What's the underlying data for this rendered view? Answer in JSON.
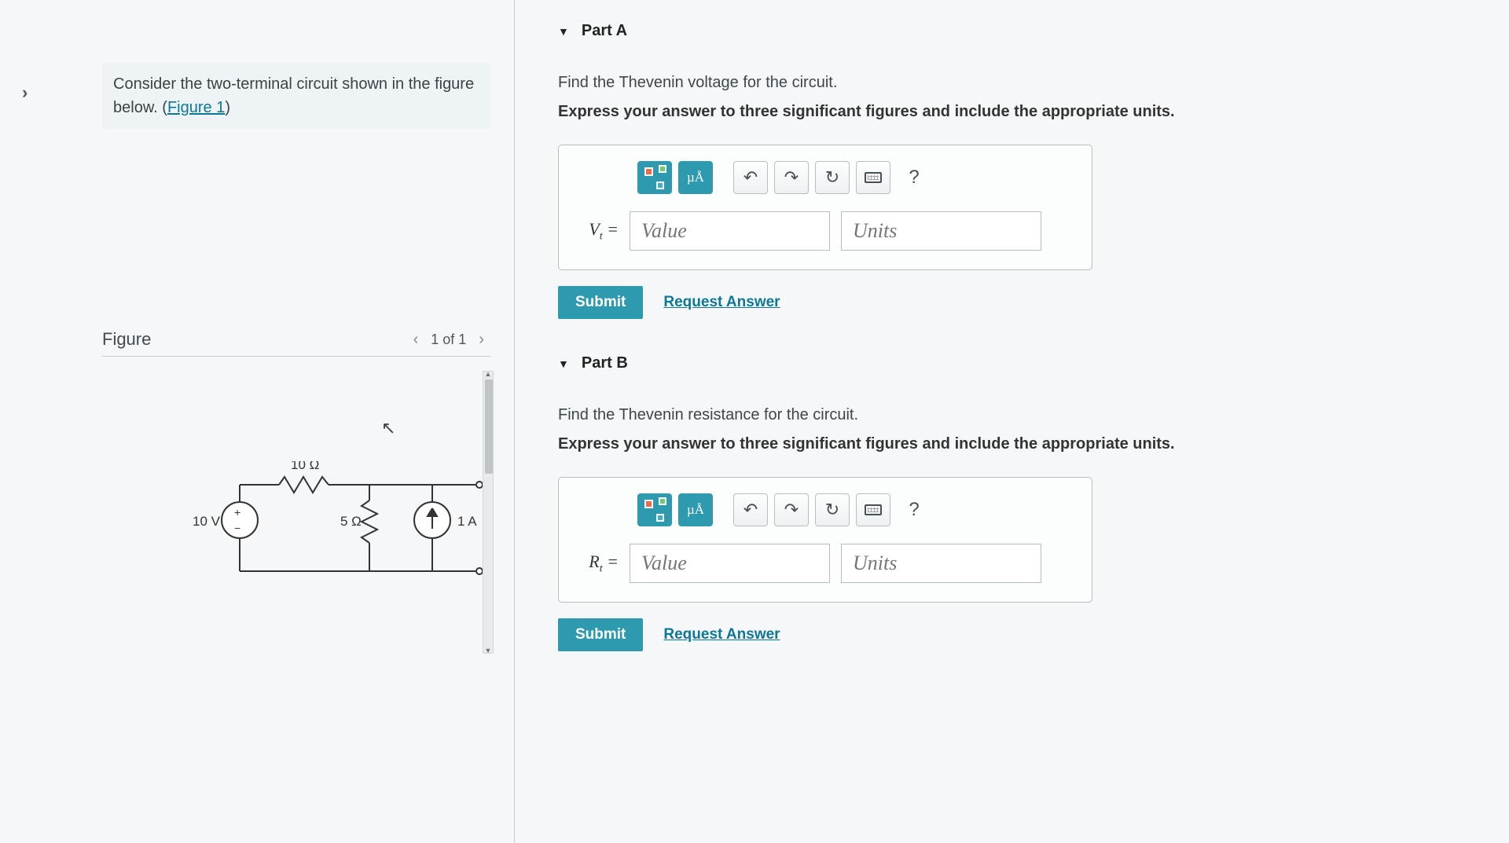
{
  "left": {
    "problem_text_1": "Consider the two-terminal circuit shown in the figure below. (",
    "figure_link": "Figure 1",
    "problem_text_2": ")",
    "figure_title": "Figure",
    "figure_nav_text": "1 of 1",
    "circuit": {
      "voltage_source": "10 V",
      "r_top": "10 Ω",
      "r_mid": "5 Ω",
      "current_source": "1 A"
    }
  },
  "parts": {
    "A": {
      "title": "Part A",
      "instruction": "Find the Thevenin voltage for the circuit.",
      "express": "Express your answer to three significant figures and include the appropriate units.",
      "var_html": "V",
      "var_sub": "t",
      "var_eq": " =",
      "value_placeholder": "Value",
      "units_placeholder": "Units",
      "units_btn": "µÅ",
      "submit": "Submit",
      "request": "Request Answer",
      "help": "?"
    },
    "B": {
      "title": "Part B",
      "instruction": "Find the Thevenin resistance for the circuit.",
      "express": "Express your answer to three significant figures and include the appropriate units.",
      "var_html": "R",
      "var_sub": "t",
      "var_eq": " =",
      "value_placeholder": "Value",
      "units_placeholder": "Units",
      "units_btn": "µÅ",
      "submit": "Submit",
      "request": "Request Answer",
      "help": "?"
    }
  },
  "expand": "›"
}
